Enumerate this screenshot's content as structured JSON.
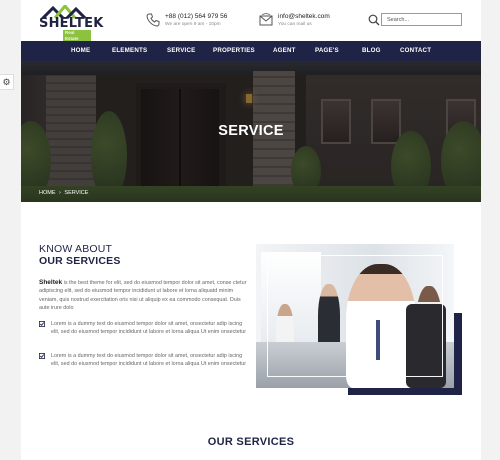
{
  "logo": {
    "name": "SHELTEK",
    "tagline": "Real Estate"
  },
  "contact": {
    "phone": "+88 (012) 564 979 56",
    "hours": "We are open 9 am - 10pm",
    "email": "info@sheltek.com",
    "email_note": "You can mail us"
  },
  "search": {
    "placeholder": "Search..."
  },
  "nav": {
    "items": [
      "HOME",
      "ELEMENTS",
      "SERVICE",
      "PROPERTIES",
      "AGENT",
      "PAGE'S",
      "BLOG",
      "CONTACT"
    ]
  },
  "hero": {
    "title": "SERVICE",
    "breadcrumb": [
      "HOME",
      "›",
      "SERVICE"
    ]
  },
  "about": {
    "heading_line1": "KNOW ABOUT",
    "heading_line2": "OUR SERVICES",
    "brand": "Sheltek",
    "intro": " is the best theme for elit, sed do eiusmod tempor dolor sit amet, conse ctetur adipiscing elit, sed do eiusmod tempor incididunt ut labore et lorna aliquatd minim veniam, quis nostrud exercitation oris nisi ut aliquip ex ea commodo consequat. Duis aute irure dolo",
    "checklist": [
      "Lorem is a dummy text do eiusmod tempor dolor sit amet, onsectetur adip iscing elit, sed do eiusmod tempor incididunt ut labore et lorna aliqua Ut enim onsectetur",
      "Lorem is a dummy text do eiusmod tempor dolor sit amet, onsectetur adip iscing elit, sed do eiusmod tempor incididunt ut labore et lorna aliqua Ut enim onsectetur"
    ]
  },
  "services": {
    "title": "OUR SERVICES"
  },
  "colors": {
    "navy": "#1f2346",
    "accent_green": "#8cc23d"
  }
}
